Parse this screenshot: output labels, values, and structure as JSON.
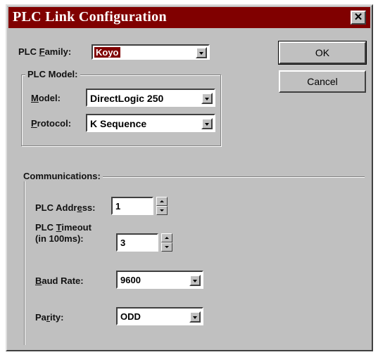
{
  "window": {
    "title": "PLC Link Configuration",
    "close_glyph": "✕"
  },
  "buttons": {
    "ok": "OK",
    "cancel": "Cancel"
  },
  "plc_family": {
    "label_pre": "PLC ",
    "label_ul": "F",
    "label_post": "amily:",
    "value": "Koyo"
  },
  "plc_model_group": {
    "title": "PLC Model:",
    "model": {
      "label_ul": "M",
      "label_post": "odel:",
      "value": "DirectLogic 250"
    },
    "protocol": {
      "label_ul": "P",
      "label_post": "rotocol:",
      "value": "K Sequence"
    }
  },
  "communications": {
    "title": "Communications:",
    "plc_address": {
      "label_pre": "PLC Addr",
      "label_ul": "e",
      "label_post": "ss:",
      "value": "1"
    },
    "plc_timeout": {
      "line1_pre": "PLC ",
      "line1_ul": "T",
      "line1_post": "imeout",
      "line2": "(in 100ms):",
      "value": "3"
    },
    "baud_rate": {
      "label_ul": "B",
      "label_post": "aud Rate:",
      "value": "9600"
    },
    "parity": {
      "label_pre": "Pa",
      "label_ul": "r",
      "label_post": "ity:",
      "value": "ODD"
    }
  }
}
